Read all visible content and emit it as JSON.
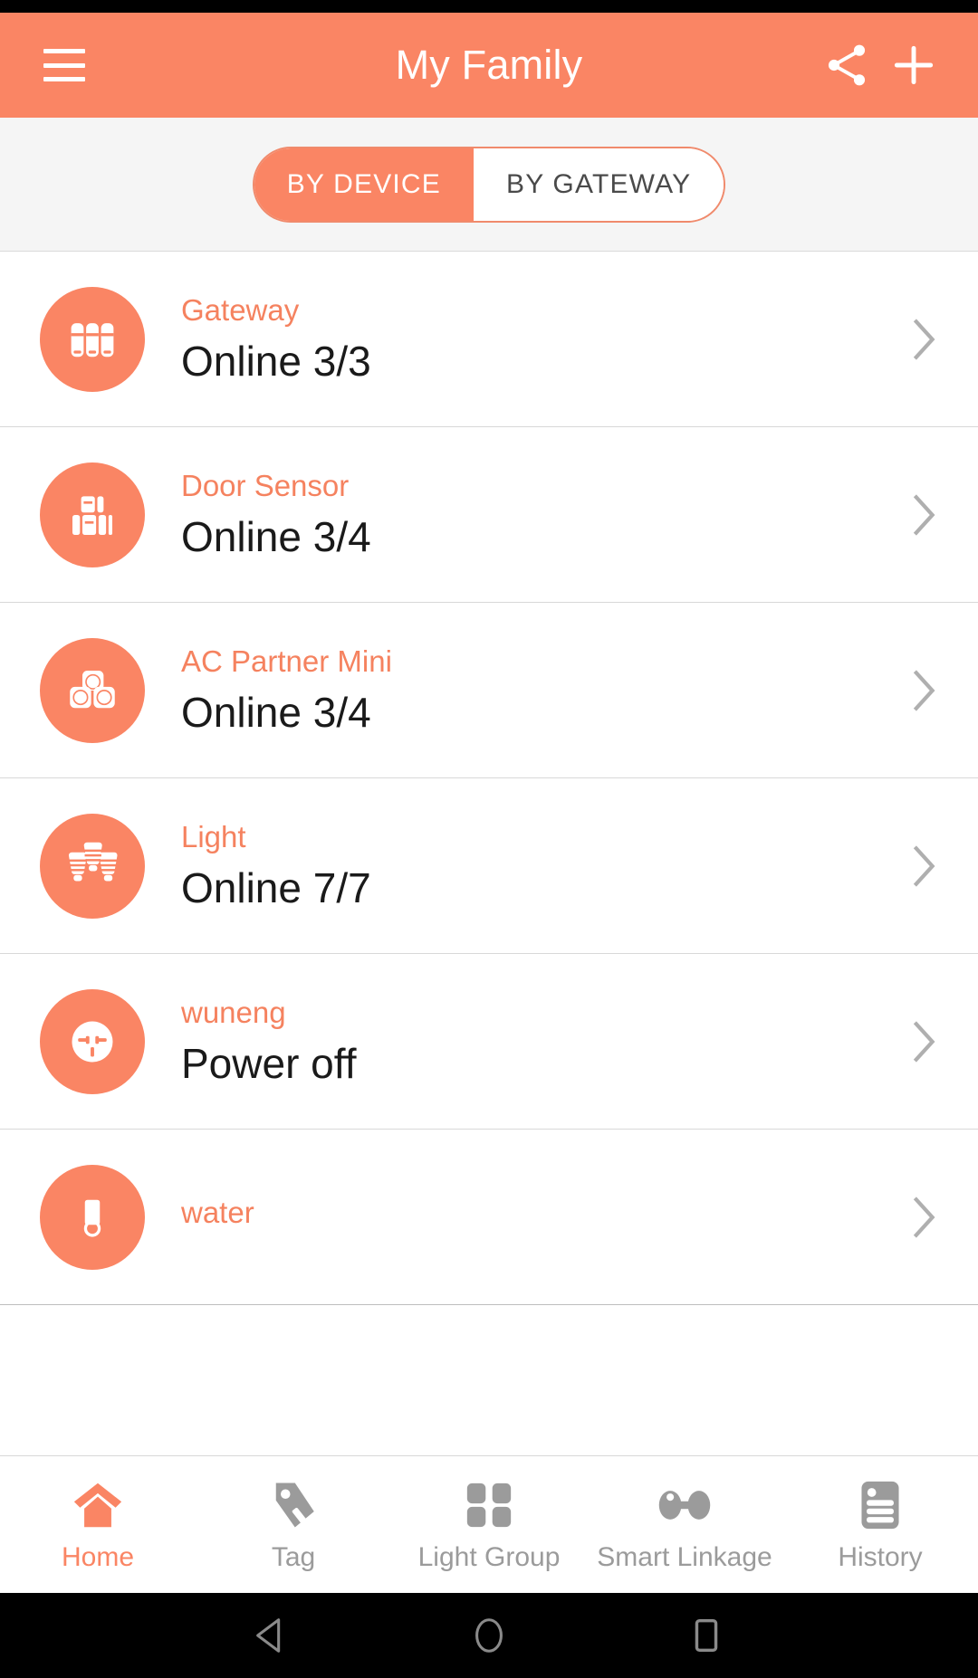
{
  "appbar": {
    "title": "My Family",
    "menu_icon": "hamburger-menu-icon",
    "share_icon": "share-icon",
    "add_icon": "plus-icon",
    "background": "#FA8564"
  },
  "segmented": {
    "options": [
      {
        "label": "BY DEVICE",
        "active": true
      },
      {
        "label": "BY GATEWAY",
        "active": false
      }
    ],
    "accent": "#FA8564",
    "border": "#F08A6C"
  },
  "devices": [
    {
      "name": "Gateway",
      "status": "Online 3/3",
      "icon": "gateway-icon"
    },
    {
      "name": "Door Sensor",
      "status": "Online 3/4",
      "icon": "door-sensor-icon"
    },
    {
      "name": "AC Partner Mini",
      "status": "Online 3/4",
      "icon": "ac-partner-icon"
    },
    {
      "name": "Light",
      "status": "Online 7/7",
      "icon": "light-bulb-icon"
    },
    {
      "name": "wuneng",
      "status": "Power off",
      "icon": "power-socket-icon"
    },
    {
      "name": "water",
      "status": "",
      "icon": "water-sensor-icon"
    }
  ],
  "tabs": [
    {
      "label": "Home",
      "icon": "home-icon",
      "active": true
    },
    {
      "label": "Tag",
      "icon": "tag-icon",
      "active": false
    },
    {
      "label": "Light Group",
      "icon": "grid-icon",
      "active": false
    },
    {
      "label": "Smart Linkage",
      "icon": "linkage-icon",
      "active": false
    },
    {
      "label": "History",
      "icon": "history-list-icon",
      "active": false
    }
  ],
  "android_nav": {
    "back": "back-triangle-icon",
    "home": "home-circle-icon",
    "recents": "recents-square-icon"
  },
  "colors": {
    "accent": "#FA8564",
    "title_text": "#F5825F",
    "status_text": "#1A1A1A",
    "inactive_tab": "#9B9B9B",
    "divider": "#D8D8D8"
  }
}
